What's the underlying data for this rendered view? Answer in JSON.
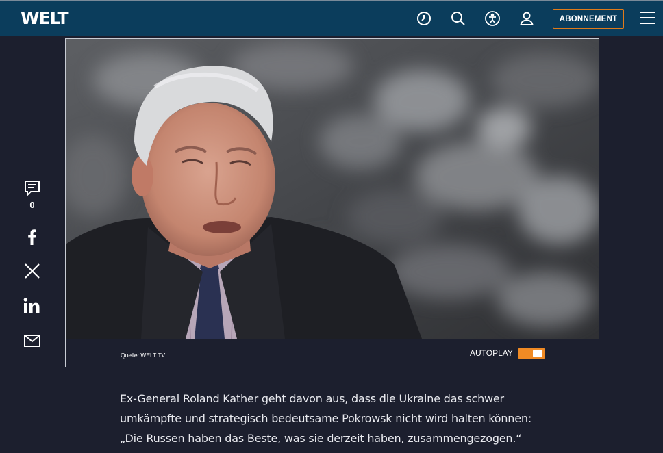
{
  "header": {
    "logo": "WELT",
    "subscribe_label": "ABONNEMENT",
    "icons": [
      "clock-icon",
      "search-icon",
      "accessibility-icon",
      "user-icon",
      "menu-icon"
    ],
    "bg_color": "#0b3d5c",
    "accent_color": "#e07b1a"
  },
  "share_bar": {
    "comment_count": "0",
    "icons": [
      "comment-icon",
      "facebook-icon",
      "x-icon",
      "linkedin-icon",
      "mail-icon"
    ]
  },
  "video": {
    "source_label": "Quelle: WELT TV",
    "autoplay_label": "AUTOPLAY",
    "autoplay_on": true,
    "toggle_color": "#f08a24"
  },
  "article": {
    "lines": [
      "Ex-General Roland Kather geht davon aus, dass die Ukraine das schwer",
      "umkämpfte und strategisch bedeutsame Pokrowsk nicht wird halten können:",
      "„Die Russen haben das Beste, was sie derzeit haben, zusammengezogen.“"
    ]
  }
}
